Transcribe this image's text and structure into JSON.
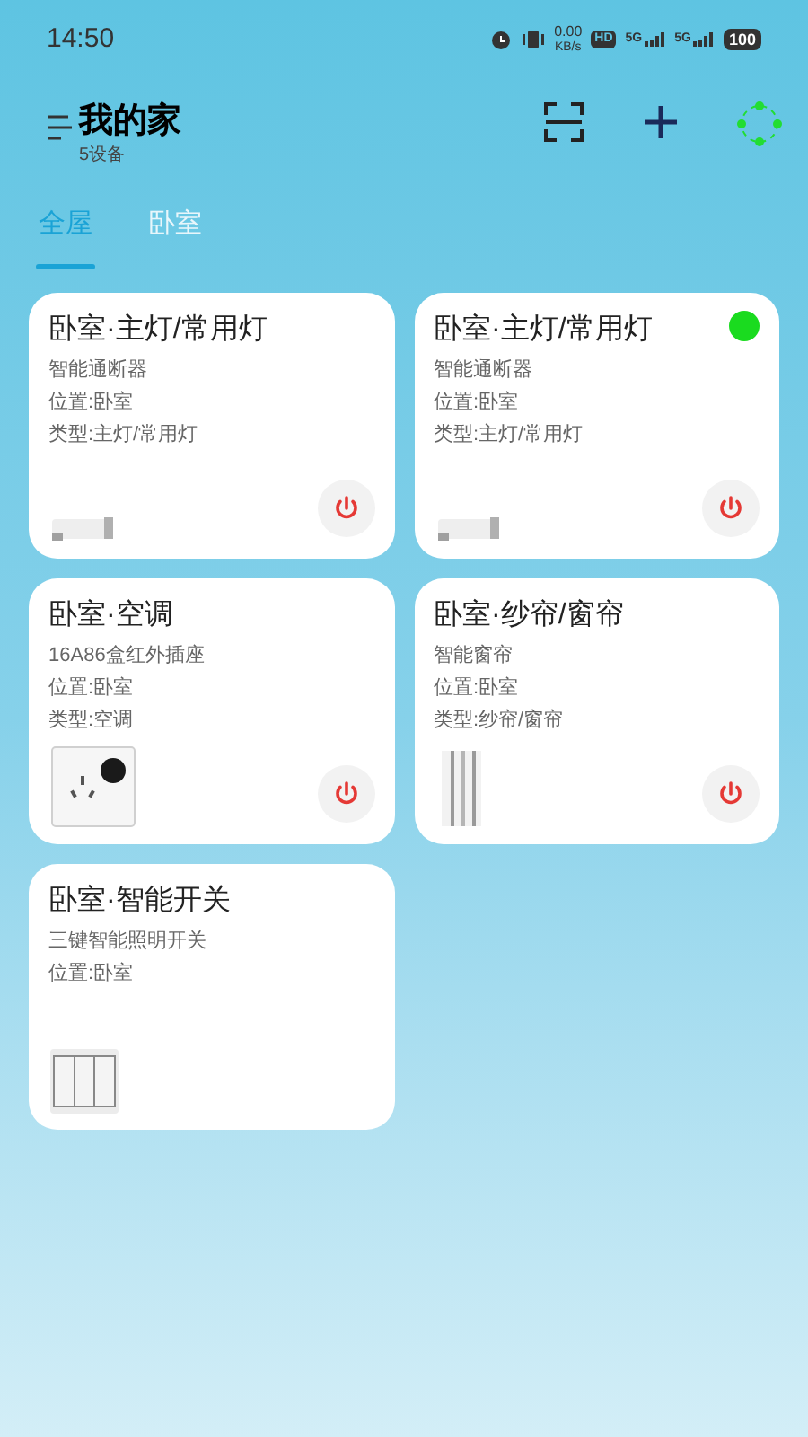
{
  "status_bar": {
    "time": "14:50",
    "speed_value": "0.00",
    "speed_unit": "KB/s",
    "hd": "HD",
    "sims": [
      "5G",
      "5G"
    ],
    "battery": "100"
  },
  "header": {
    "title": "我的家",
    "subtitle": "5设备"
  },
  "tabs": [
    {
      "label": "全屋",
      "selected": true
    },
    {
      "label": "卧室",
      "selected": false
    }
  ],
  "devices": [
    {
      "name": "卧室·主灯/常用灯",
      "model": "智能通断器",
      "location": "位置:卧室",
      "type": "类型:主灯/常用灯",
      "kind": "breaker",
      "online": false,
      "power_button": true
    },
    {
      "name": "卧室·主灯/常用灯",
      "model": "智能通断器",
      "location": "位置:卧室",
      "type": "类型:主灯/常用灯",
      "kind": "breaker",
      "online": true,
      "power_button": true
    },
    {
      "name": "卧室·空调",
      "model": "16A86盒红外插座",
      "location": "位置:卧室",
      "type": "类型:空调",
      "kind": "socket",
      "online": false,
      "power_button": true
    },
    {
      "name": "卧室·纱帘/窗帘",
      "model": "智能窗帘",
      "location": "位置:卧室",
      "type": "类型:纱帘/窗帘",
      "kind": "curtain",
      "online": false,
      "power_button": true
    },
    {
      "name": "卧室·智能开关",
      "model": "三键智能照明开关",
      "location": "位置:卧室",
      "kind": "switch",
      "online": false,
      "power_button": false
    }
  ]
}
